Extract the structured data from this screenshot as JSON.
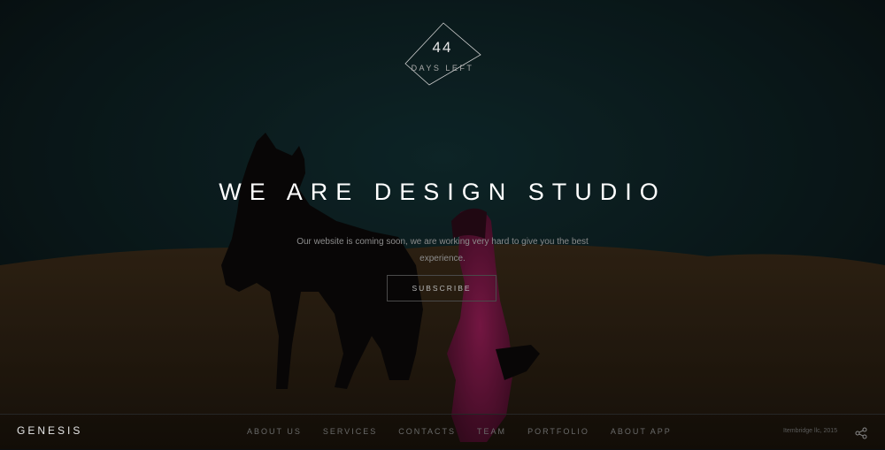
{
  "countdown": {
    "number": "44",
    "label": "DAYS LEFT"
  },
  "hero": {
    "headline": "WE ARE DESIGN STUDIO",
    "tagline": "Our website is coming soon, we are working very hard to give you the best experience.",
    "subscribe_label": "SUBSCRIBE"
  },
  "footer": {
    "brand": "GENESIS",
    "nav": [
      {
        "label": "ABOUT US"
      },
      {
        "label": "SERVICES"
      },
      {
        "label": "CONTACTS"
      },
      {
        "label": "TEAM"
      },
      {
        "label": "PORTFOLIO"
      },
      {
        "label": "ABOUT APP"
      }
    ],
    "copyright": "Itembridge llc, 2015",
    "share_icon": "share-icon"
  },
  "colors": {
    "sky": "#0f2a2c",
    "sand": "#3a2a17",
    "dress": "#8a1a4e",
    "text": "#ffffff"
  }
}
